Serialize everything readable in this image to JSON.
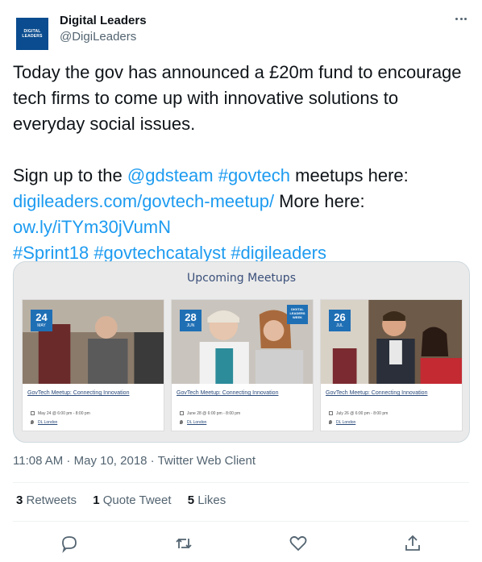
{
  "author": {
    "display_name": "Digital Leaders",
    "handle": "@DigiLeaders",
    "avatar_text_line1": "DIGITAL",
    "avatar_text_line2": "LEADERS"
  },
  "tweet": {
    "line1": "Today the gov has announced a £20m fund to encourage tech firms to come up with innovative solutions to everyday social issues.",
    "p2_text1": "Sign up to the ",
    "p2_mention": "@gdsteam",
    "p2_space1": " ",
    "p2_hashtag": "#govtech",
    "p2_text2": " meetups here:",
    "p2_link1": "digileaders.com/govtech-meetup/",
    "p2_text3": " More here:",
    "p2_link2": "ow.ly/iTYm30jVumN",
    "hashtag1": "#Sprint18",
    "hashtag2": "#govtechcatalyst",
    "hashtag3": "#digileaders"
  },
  "card": {
    "title": "Upcoming Meetups",
    "events": [
      {
        "day": "24",
        "month": "MAY",
        "title": "GovTech Meetup: Connecting Innovation",
        "date": "May 24 @ 6:00 pm - 8:00 pm",
        "location": "DL London"
      },
      {
        "day": "28",
        "month": "JUN",
        "title": "GovTech Meetup: Connecting Innovation",
        "date": "June 28 @ 6:00 pm - 8:00 pm",
        "location": "DL London",
        "week_badge": "DIGITAL LEADERS WEEK"
      },
      {
        "day": "26",
        "month": "JUL",
        "title": "GovTech Meetup: Connecting Innovation",
        "date": "July 26 @ 6:00 pm - 8:00 pm",
        "location": "DL London"
      }
    ]
  },
  "meta": {
    "time": "11:08 AM",
    "separator": " · ",
    "date": "May 10, 2018",
    "client": "Twitter Web Client"
  },
  "stats": {
    "retweets_count": "3",
    "retweets_label": " Retweets",
    "quotes_count": "1",
    "quotes_label": " Quote Tweet",
    "likes_count": "5",
    "likes_label": " Likes"
  },
  "icons": {
    "reply": "reply-icon",
    "retweet": "retweet-icon",
    "like": "like-icon",
    "share": "share-icon",
    "more": "more-icon"
  },
  "colors": {
    "link": "#1d9bf0",
    "text": "#0f1419",
    "secondary": "#536471",
    "brand_blue": "#0a4c8f"
  }
}
